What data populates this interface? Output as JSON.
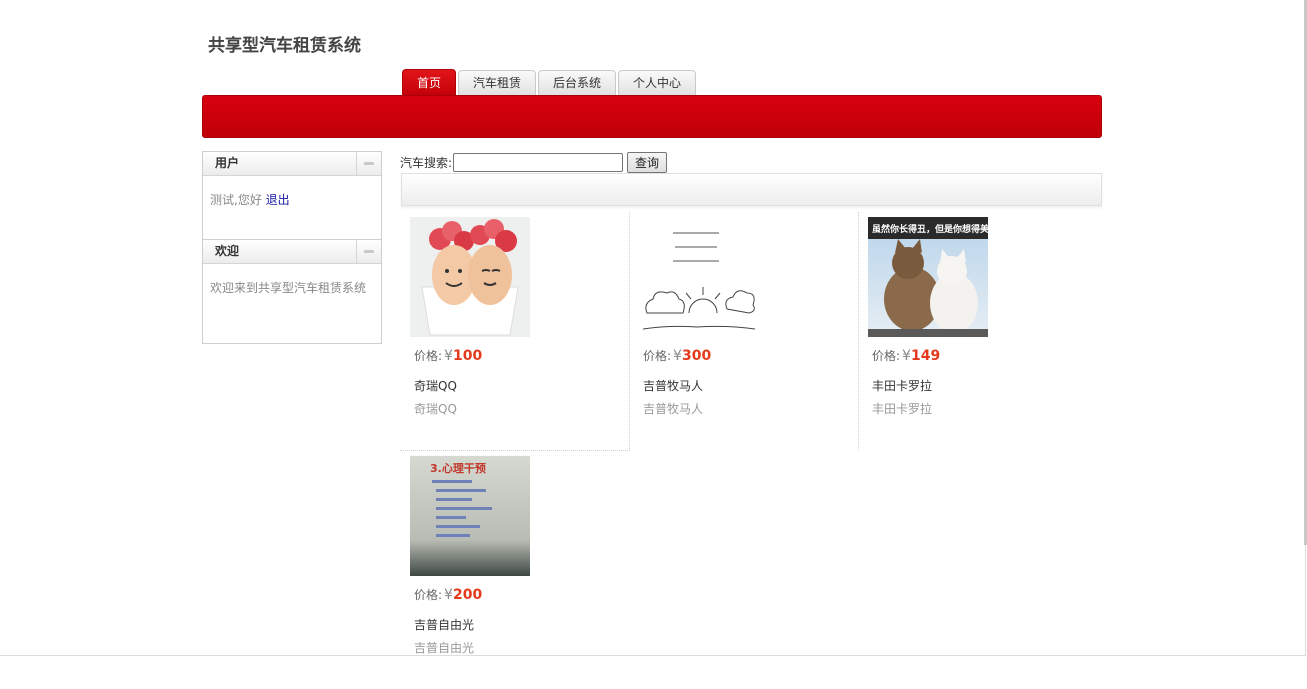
{
  "site": {
    "title": "共享型汽车租赁系统"
  },
  "nav": {
    "tabs": [
      {
        "label": "首页",
        "active": true
      },
      {
        "label": "汽车租赁",
        "active": false
      },
      {
        "label": "后台系统",
        "active": false
      },
      {
        "label": "个人中心",
        "active": false
      }
    ]
  },
  "sidebar": {
    "user_panel": {
      "title": "用户",
      "greeting": "测试,您好",
      "logout_link": "退出"
    },
    "welcome_panel": {
      "title": "欢迎",
      "text": "欢迎来到共享型汽车租赁系统"
    }
  },
  "search": {
    "label": "汽车搜索:",
    "value": "",
    "button": "查询"
  },
  "products": [
    {
      "price_label": "价格:",
      "currency": "¥",
      "price": "100",
      "name": "奇瑞QQ",
      "desc": "奇瑞QQ",
      "image_icon": "eggs-photo"
    },
    {
      "price_label": "价格:",
      "currency": "¥",
      "price": "300",
      "name": "吉普牧马人",
      "desc": "吉普牧马人",
      "image_icon": "sketch-sun-photo"
    },
    {
      "price_label": "价格:",
      "currency": "¥",
      "price": "149",
      "name": "丰田卡罗拉",
      "desc": "丰田卡罗拉",
      "image_icon": "cats-photo",
      "image_caption": "虽然你长得丑，但是你想得美啊!"
    },
    {
      "price_label": "价格:",
      "currency": "¥",
      "price": "200",
      "name": "吉普自由光",
      "desc": "吉普自由光",
      "image_icon": "slide-photo",
      "image_caption": "3.心理干预"
    }
  ],
  "colors": {
    "brand_red": "#c8000a",
    "price_red": "#e4391b",
    "link_blue": "#1a1aa6"
  }
}
